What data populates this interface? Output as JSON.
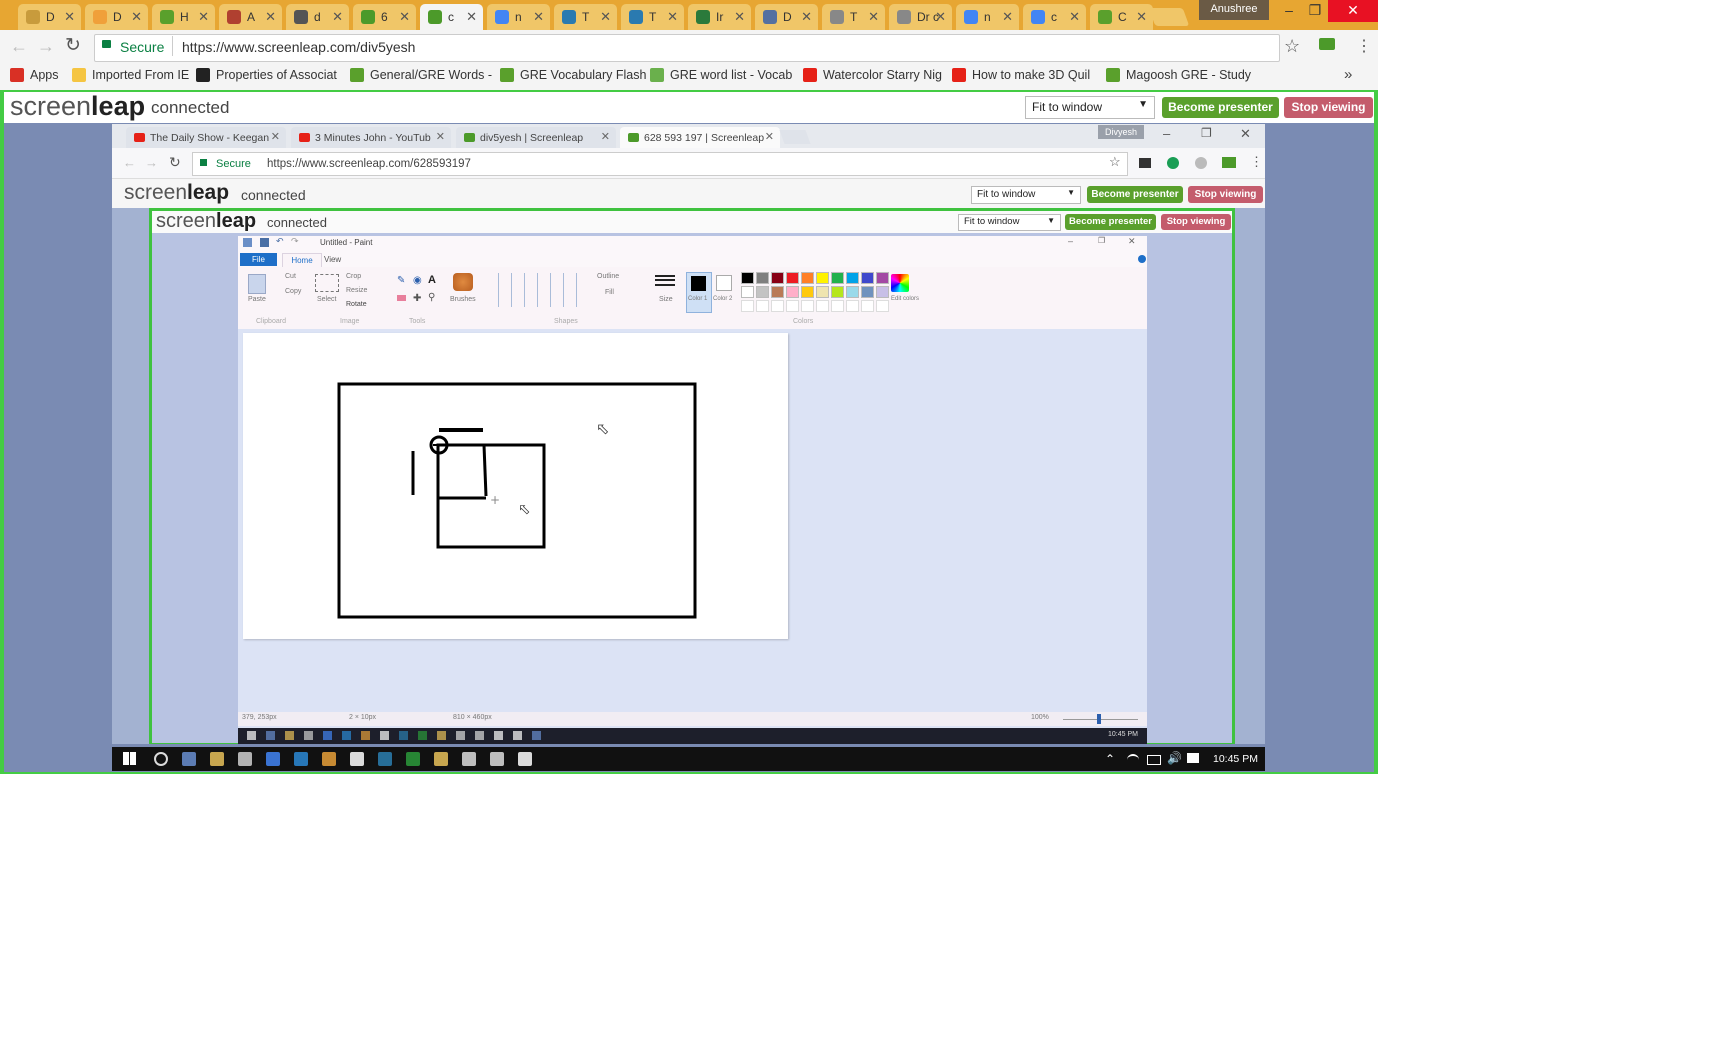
{
  "outer_tabs": [
    {
      "label": "D",
      "color": "#c89b3c"
    },
    {
      "label": "D",
      "color": "#f0a03a"
    },
    {
      "label": "H",
      "color": "#5aa02c"
    },
    {
      "label": "A",
      "color": "#b04030"
    },
    {
      "label": "d",
      "color": "#555555"
    },
    {
      "label": "6",
      "color": "#4c9a2a"
    },
    {
      "label": "c",
      "color": "#4c9a2a",
      "active": true
    },
    {
      "label": "n",
      "color": "#4285f4"
    },
    {
      "label": "T",
      "color": "#2a7ab0"
    },
    {
      "label": "T",
      "color": "#2a7ab0"
    },
    {
      "label": "Ir",
      "color": "#2b7a3b"
    },
    {
      "label": "D",
      "color": "#5570a0"
    },
    {
      "label": "T",
      "color": "#888888"
    },
    {
      "label": "Dr c",
      "color": "#888888"
    },
    {
      "label": "n",
      "color": "#4285f4"
    },
    {
      "label": "c",
      "color": "#4285f4"
    },
    {
      "label": "C",
      "color": "#5aa02c"
    }
  ],
  "profile_name": "Anushree",
  "omnibox": {
    "secure_label": "Secure",
    "url": "https://www.screenleap.com/div5yesh"
  },
  "bookmarks": [
    {
      "label": "Apps",
      "icon": "apps-grid-icon",
      "color": "#d93025"
    },
    {
      "label": "Imported From IE",
      "icon": "folder-icon",
      "color": "#f5c542"
    },
    {
      "label": "Properties of Associat",
      "icon": "m-icon",
      "color": "#222222"
    },
    {
      "label": "General/GRE Words -",
      "icon": "link-icon",
      "color": "#5aa02c"
    },
    {
      "label": "GRE Vocabulary Flash",
      "icon": "link-icon",
      "color": "#5aa02c"
    },
    {
      "label": "GRE word list - Vocab",
      "icon": "check-icon",
      "color": "#6ab04c"
    },
    {
      "label": "Watercolor Starry Nig",
      "icon": "youtube-icon",
      "color": "#e62117"
    },
    {
      "label": "How to make 3D Quil",
      "icon": "youtube-icon",
      "color": "#e62117"
    },
    {
      "label": "Magoosh GRE - Study",
      "icon": "link-icon",
      "color": "#5aa02c"
    }
  ],
  "screenleap": {
    "logo_light": "screen",
    "logo_bold": "leap",
    "status": "connected",
    "fit_option": "Fit to window",
    "become_presenter": "Become presenter",
    "stop_viewing": "Stop viewing"
  },
  "inner_browser": {
    "tabs": [
      {
        "label": "The Daily Show - Keegan",
        "color": "#e62117"
      },
      {
        "label": "3 Minutes John - YouTub",
        "color": "#e62117"
      },
      {
        "label": "div5yesh | Screenleap",
        "color": "#4c9a2a"
      },
      {
        "label": "628 593 197 | Screenleap",
        "color": "#4c9a2a",
        "active": true
      }
    ],
    "profile": "Divyesh",
    "secure_label": "Secure",
    "url": "https://www.screenleap.com/628593197"
  },
  "paint": {
    "title": "Untitled - Paint",
    "tabs": [
      "File",
      "Home",
      "View"
    ],
    "groups": [
      "Clipboard",
      "Image",
      "Tools",
      "Shapes",
      "Colors"
    ],
    "tools": {
      "paste": "Paste",
      "cut": "Cut",
      "copy": "Copy",
      "select": "Select",
      "crop": "Crop",
      "resize": "Resize",
      "rotate": "Rotate",
      "brushes": "Brushes",
      "outline": "Outline",
      "fill": "Fill",
      "size": "Size",
      "color1": "Color 1",
      "color2": "Color 2",
      "edit_colors": "Edit colors"
    },
    "palette": [
      "#000000",
      "#7f7f7f",
      "#880015",
      "#ed1c24",
      "#ff7f27",
      "#fff200",
      "#22b14c",
      "#00a2e8",
      "#3f48cc",
      "#a349a4",
      "#ffffff",
      "#c3c3c3",
      "#b97a57",
      "#ffaec9",
      "#ffc90e",
      "#efe4b0",
      "#b5e61d",
      "#99d9ea",
      "#7092be",
      "#c8bfe7"
    ],
    "status": {
      "cursor": "379, 253px",
      "selection": "2 × 10px",
      "size": "810 × 460px",
      "zoom": "100%"
    },
    "inner_clock": "10:45 PM"
  },
  "taskbar": {
    "clock": "10:45 PM"
  }
}
